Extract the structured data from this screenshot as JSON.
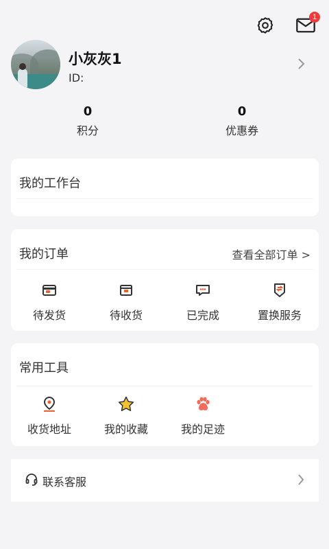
{
  "header": {
    "settings_icon": "gear-icon",
    "messages_icon": "envelope-icon",
    "message_badge": "1"
  },
  "profile": {
    "name": "小灰灰1",
    "id_label": "ID:",
    "avatar": "landscape-photo-avatar"
  },
  "stats": {
    "points": {
      "value": "0",
      "label": "积分"
    },
    "coupons": {
      "value": "0",
      "label": "优惠券"
    }
  },
  "workbench": {
    "title": "我的工作台"
  },
  "orders": {
    "title": "我的订单",
    "view_all": "查看全部订单 >",
    "items": [
      {
        "label": "待发货",
        "icon": "wallet-icon"
      },
      {
        "label": "待收货",
        "icon": "package-icon"
      },
      {
        "label": "已完成",
        "icon": "chat-bubble-icon"
      },
      {
        "label": "置换服务",
        "icon": "exchange-icon"
      }
    ]
  },
  "tools": {
    "title": "常用工具",
    "items": [
      {
        "label": "收货地址",
        "icon": "location-icon"
      },
      {
        "label": "我的收藏",
        "icon": "star-icon"
      },
      {
        "label": "我的足迹",
        "icon": "paw-icon"
      }
    ]
  },
  "support": {
    "label": "联系客服",
    "icon": "headset-icon"
  },
  "colors": {
    "background": "#f4f4f6",
    "card": "#ffffff",
    "accent_orange": "#e9622f",
    "badge_red": "#ee3b3b",
    "star_yellow": "#f1c232",
    "paw_red": "#f36b5b"
  }
}
